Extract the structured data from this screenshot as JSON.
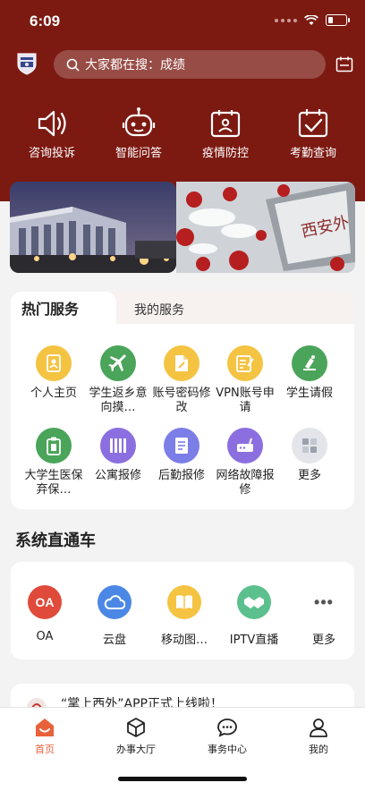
{
  "status": {
    "time": "6:09"
  },
  "search": {
    "placeholder": "大家都在搜：成绩"
  },
  "quick_actions": [
    {
      "label": "咨询投诉",
      "icon": "speaker-icon"
    },
    {
      "label": "智能问答",
      "icon": "robot-icon"
    },
    {
      "label": "疫情防控",
      "icon": "id-card-icon"
    },
    {
      "label": "考勤查询",
      "icon": "calendar-check-icon"
    }
  ],
  "tabs": {
    "active": "热门服务",
    "other": "我的服务"
  },
  "services": [
    {
      "label": "个人主页",
      "color": "#f5c342",
      "icon": "profile-icon"
    },
    {
      "label": "学生返乡意向摸…",
      "color": "#4aa45a",
      "icon": "airplane-icon"
    },
    {
      "label": "账号密码修改",
      "color": "#f5c342",
      "icon": "document-edit-icon"
    },
    {
      "label": "VPN账号申请",
      "color": "#f5c342",
      "icon": "form-icon"
    },
    {
      "label": "学生请假",
      "color": "#4aa45a",
      "icon": "leave-icon"
    },
    {
      "label": "大学生医保弃保…",
      "color": "#4aa45a",
      "icon": "clipboard-icon"
    },
    {
      "label": "公寓报修",
      "color": "#8b6fe0",
      "icon": "apartment-icon"
    },
    {
      "label": "后勤报修",
      "color": "#7b7ee6",
      "icon": "repair-form-icon"
    },
    {
      "label": "网络故障报修",
      "color": "#8b6fe0",
      "icon": "router-icon"
    },
    {
      "label": "更多",
      "color": "#e3e5ea",
      "icon": "grid-more-icon"
    }
  ],
  "section": {
    "title": "系统直通车"
  },
  "systems": [
    {
      "label": "OA",
      "badge": "OA",
      "color": "#e04a3a"
    },
    {
      "label": "云盘",
      "badge": "",
      "color": "#4b87e5"
    },
    {
      "label": "移动图…",
      "badge": "",
      "color": "#f5c342"
    },
    {
      "label": "IPTV直播",
      "badge": "",
      "color": "#5cc08e"
    },
    {
      "label": "更多",
      "badge": "•••",
      "color": "#ffffff"
    }
  ],
  "news": {
    "text": "“掌上西外”APP正式上线啦！"
  },
  "tabbar": [
    {
      "label": "首页",
      "active": true
    },
    {
      "label": "办事大厅",
      "active": false
    },
    {
      "label": "事务中心",
      "active": false
    },
    {
      "label": "我的",
      "active": false
    }
  ],
  "colors": {
    "header": "#7c1a12",
    "accent": "#e8613a"
  }
}
